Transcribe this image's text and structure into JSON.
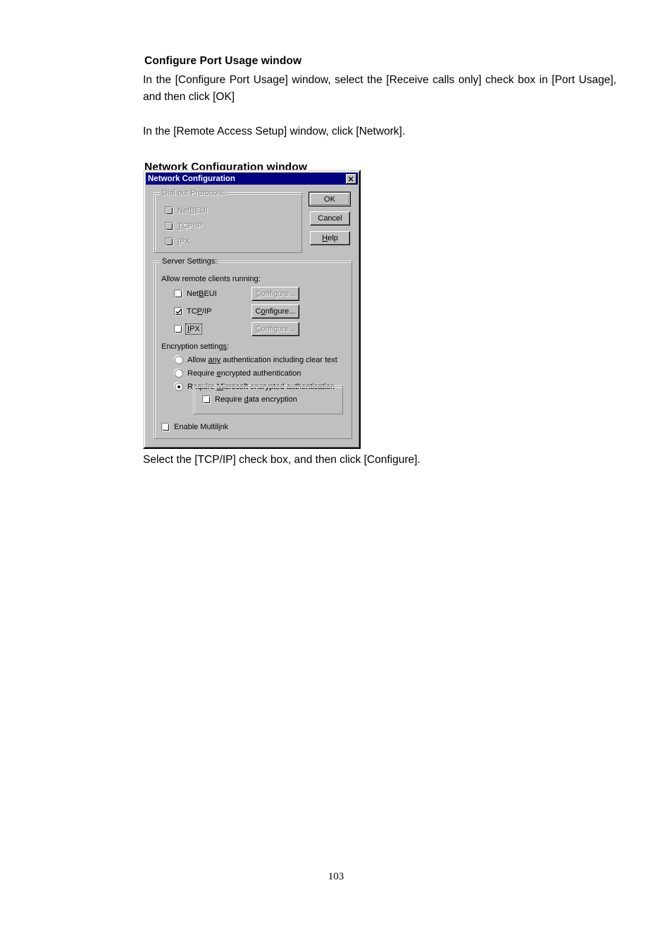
{
  "document": {
    "section1_heading": "Configure Port Usage window",
    "section1_para": "In the [Configure Port Usage] window, select the [Receive calls only] check box in [Port Usage], and then click [OK]",
    "section1_para2": "In the [Remote Access Setup] window, click [Network].",
    "section2_heading": "Network Configuration window",
    "closing_text": "Select the [TCP/IP] check box, and then click [Configure].",
    "page_number": "103"
  },
  "dialog": {
    "title": "Network Configuration",
    "close_label": "close-icon",
    "buttons": {
      "ok": "OK",
      "cancel": "Cancel",
      "help_pre": "H",
      "help_post": "elp"
    },
    "dial_out": {
      "legend": "Dial out Protocols:",
      "items": [
        {
          "label_pre": "Net",
          "label_key": "B",
          "label_post": "EUI",
          "checked": false,
          "disabled": true
        },
        {
          "label_pre": "",
          "label_key": "T",
          "label_post": "CP/IP",
          "checked": false,
          "disabled": true
        },
        {
          "label_pre": "",
          "label_key": "I",
          "label_post": "PX",
          "checked": false,
          "disabled": true
        }
      ]
    },
    "server_settings": {
      "legend": "Server Settings:",
      "allow_label_pre": "Allow remote clients runnin",
      "allow_label_key": "g",
      "allow_label_post": ":",
      "protocols": [
        {
          "label_pre": "Net",
          "label_key": "B",
          "label_post": "EUI",
          "checked": false,
          "disabled": false,
          "focused": false,
          "configure": "Configure...",
          "configure_key": "C",
          "configure_pre": "",
          "configure_post": "onfigure...",
          "configure_disabled": true
        },
        {
          "label_pre": "TC",
          "label_key": "P",
          "label_post": "/IP",
          "checked": true,
          "disabled": false,
          "focused": false,
          "configure": "Configure...",
          "configure_key": "o",
          "configure_pre": "C",
          "configure_post": "nfigure...",
          "configure_disabled": false
        },
        {
          "label_pre": "",
          "label_key": "I",
          "label_post": "PX",
          "checked": false,
          "disabled": false,
          "focused": true,
          "configure": "Configure...",
          "configure_key": "C",
          "configure_pre": "",
          "configure_post": "onfigure...",
          "configure_disabled": true
        }
      ],
      "encryption_label_pre": "Encryption setting",
      "encryption_label_key": "s",
      "encryption_label_post": ":",
      "encryption_options": [
        {
          "pre": "Allow ",
          "key": "any",
          "post": " authentication including clear text",
          "selected": false
        },
        {
          "pre": "Require ",
          "key": "e",
          "post": "ncrypted authentication",
          "selected": false
        },
        {
          "pre": "Require ",
          "key": "M",
          "post": "icrosoft encrypted authentication",
          "selected": true
        }
      ],
      "data_encryption": {
        "pre": "Require ",
        "key": "d",
        "post": "ata encryption",
        "checked": false
      },
      "enable_multilink": {
        "pre": "Enable Multil",
        "key": "i",
        "post": "nk",
        "checked": false
      }
    }
  },
  "colors": {
    "titlebar": "#000080",
    "face": "#c0c0c0",
    "shadow": "#808080",
    "highlight": "#ffffff"
  }
}
